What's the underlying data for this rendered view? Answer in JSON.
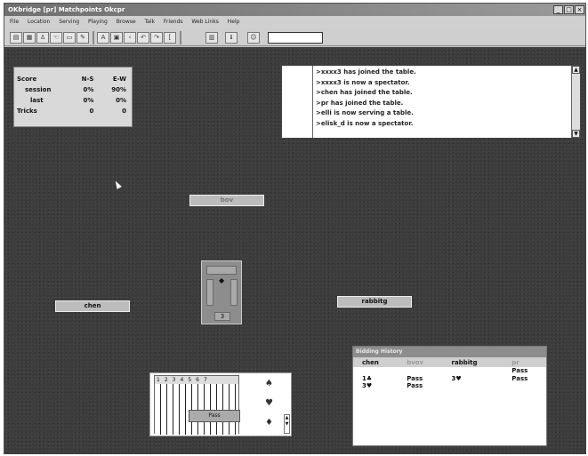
{
  "window": {
    "title": "OKbridge [pr] Matchpoints Okcpr",
    "min": "_",
    "max": "□",
    "close": "×"
  },
  "menu": [
    "File",
    "Location",
    "Serving",
    "Playing",
    "Browse",
    "Talk",
    "Friends",
    "Web Links",
    "Help"
  ],
  "toolbar": {
    "icons": [
      "table-icon",
      "grid-icon",
      "players-icon",
      "hand-icon",
      "cards-icon",
      "hint-icon",
      "text-a-icon",
      "text-b-icon",
      "left-icon",
      "undo-icon",
      "redo-icon",
      "calendar-icon",
      "info-icon",
      "people-icon"
    ],
    "search_value": ""
  },
  "score": {
    "headers": [
      "Score",
      "N-S",
      "E-W"
    ],
    "rows": [
      {
        "label": "session",
        "ns": "0%",
        "ew": "90%"
      },
      {
        "label": "last",
        "ns": "0%",
        "ew": "0%"
      },
      {
        "label": "Tricks",
        "ns": "0",
        "ew": "0"
      }
    ]
  },
  "chat": {
    "lines": [
      ">xxxx3 has joined the table.",
      ">xxxx3 is now a spectator.",
      ">chen has joined the table.",
      ">pr has joined the table.",
      ">elli is now serving a table.",
      ">elisk_d is now a spectator."
    ]
  },
  "seats": {
    "north": "bov",
    "west": "chen",
    "east": "rabbitg"
  },
  "table_center": {
    "deal_number": "3"
  },
  "bidbox": {
    "suits": [
      "♠",
      "♥",
      "♦"
    ],
    "numbers": [
      "1",
      "2",
      "3",
      "4",
      "5",
      "6",
      "7"
    ],
    "pass_label": "Pass"
  },
  "bidding": {
    "title": "Bidding History",
    "columns": [
      "chen",
      "bvov",
      "rabbitg",
      "pr"
    ],
    "rows": [
      [
        "",
        "",
        "",
        "Pass"
      ],
      [
        "1♣",
        "Pass",
        "3♥",
        "Pass"
      ],
      [
        "3♥",
        "Pass",
        "",
        ""
      ]
    ]
  }
}
